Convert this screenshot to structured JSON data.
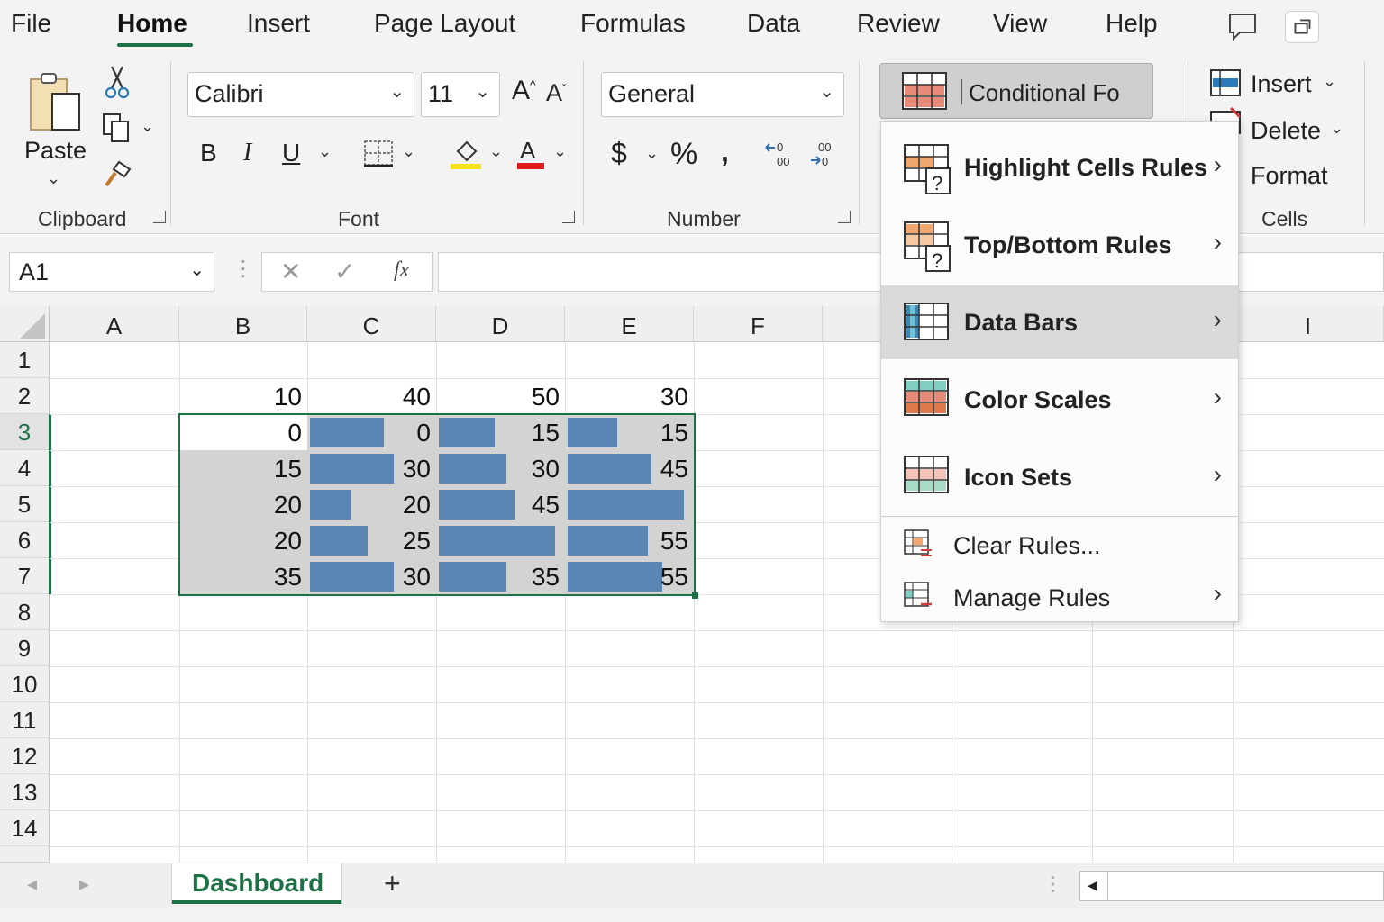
{
  "ribbon_tabs": [
    "File",
    "Home",
    "Insert",
    "Page Layout",
    "Formulas",
    "Data",
    "Review",
    "View",
    "Help"
  ],
  "active_tab": "Home",
  "clipboard": {
    "paste_label": "Paste",
    "group_label": "Clipboard"
  },
  "font": {
    "name": "Calibri",
    "size": "11",
    "bold": "B",
    "italic": "I",
    "underline": "U",
    "group_label": "Font"
  },
  "number": {
    "format": "General",
    "group_label": "Number"
  },
  "styles": {
    "conditional_formatting_label": "Conditional Fo"
  },
  "cells_group": {
    "insert_label": "Insert",
    "delete_label": "Delete",
    "format_label": "Format",
    "group_label": "Cells"
  },
  "formula_bar": {
    "name_box": "A1",
    "fx": "fx",
    "value": ""
  },
  "columns": [
    "A",
    "B",
    "C",
    "D",
    "E",
    "F",
    "I"
  ],
  "rows": [
    "1",
    "2",
    "3",
    "4",
    "5",
    "6",
    "7",
    "8",
    "9",
    "10",
    "11",
    "12",
    "13",
    "14"
  ],
  "sheet": {
    "row2": [
      "10",
      "40",
      "50",
      "30"
    ],
    "data": [
      [
        "0",
        "0",
        "15",
        "15"
      ],
      [
        "15",
        "30",
        "30",
        "45"
      ],
      [
        "20",
        "20",
        "45",
        ""
      ],
      [
        "20",
        "25",
        "",
        "55"
      ],
      [
        "35",
        "30",
        "35",
        "55"
      ]
    ],
    "bar_fractions": [
      [
        null,
        0.6,
        0.45,
        0.4
      ],
      [
        null,
        0.68,
        0.55,
        0.68
      ],
      [
        null,
        0.33,
        0.62,
        0.94
      ],
      [
        null,
        0.47,
        0.94,
        0.65
      ],
      [
        null,
        0.68,
        0.55,
        0.77
      ]
    ]
  },
  "cf_menu": {
    "items": [
      {
        "label": "Highlight Cells Rules",
        "icon": "highlight-rules-icon"
      },
      {
        "label": "Top/Bottom Rules",
        "icon": "top-bottom-rules-icon"
      },
      {
        "label": "Data Bars",
        "icon": "data-bars-icon"
      },
      {
        "label": "Color Scales",
        "icon": "color-scales-icon"
      },
      {
        "label": "Icon Sets",
        "icon": "icon-sets-icon"
      },
      {
        "label": "Clear Rules...",
        "icon": "clear-rules-icon"
      },
      {
        "label": "Manage Rules",
        "icon": "manage-rules-icon"
      }
    ],
    "highlighted": "Data Bars"
  },
  "sheet_tabs": {
    "active": "Dashboard",
    "add": "+"
  },
  "colors": {
    "accent": "#1e7145",
    "data_bar": "#5b86b4",
    "selection": "#d3d3d3"
  }
}
